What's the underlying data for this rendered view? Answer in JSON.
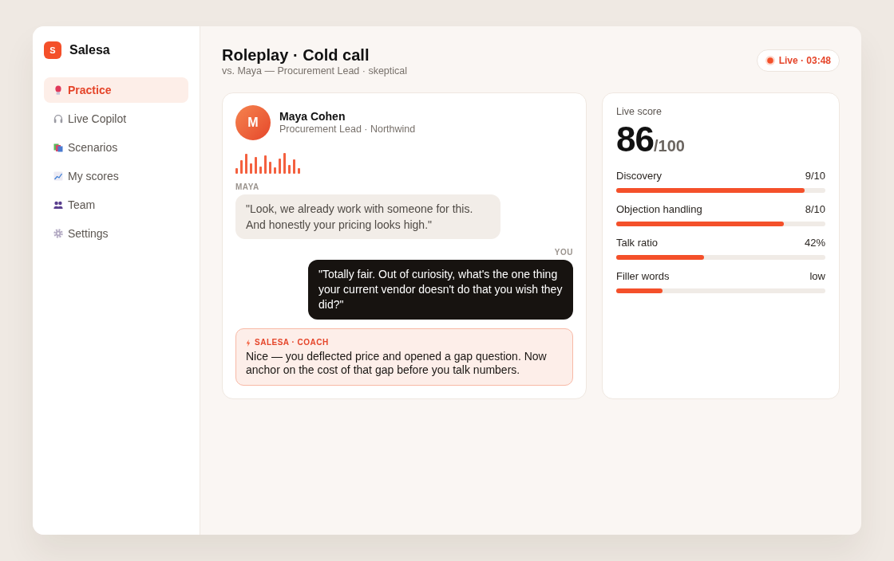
{
  "app": {
    "logo_letter": "S",
    "name": "Salesa"
  },
  "sidebar": {
    "items": [
      {
        "label": "Practice",
        "selected": true
      },
      {
        "label": "Live Copilot",
        "selected": false
      },
      {
        "label": "Scenarios",
        "selected": false
      },
      {
        "label": "My scores",
        "selected": false
      },
      {
        "label": "Team",
        "selected": false
      },
      {
        "label": "Settings",
        "selected": false
      }
    ]
  },
  "header": {
    "title": "Roleplay · Cold call",
    "subtitle": "vs. Maya — Procurement Lead · skeptical",
    "live_badge": {
      "label": "Live · 03:48"
    }
  },
  "conversation": {
    "contact": {
      "initial": "M",
      "name": "Maya Cohen",
      "role": "Procurement Lead · Northwind"
    },
    "messages": [
      {
        "kind": "prospect",
        "sender": "MAYA",
        "text": "\"Look, we already work with someone for this. And honestly your pricing looks high.\""
      },
      {
        "kind": "user",
        "sender": "YOU",
        "text": "\"Totally fair. Out of curiosity, what's the one thing your current vendor doesn't do that you wish they did?\""
      },
      {
        "kind": "coach",
        "sender": "SALESA · COACH",
        "text": "Nice — you deflected price and opened a gap question. Now anchor on the cost of that gap before you talk numbers."
      }
    ]
  },
  "score": {
    "title": "Live score",
    "value": "86",
    "max": "/100",
    "metrics": [
      {
        "label": "Discovery",
        "reading": "9/10",
        "level": 0.9
      },
      {
        "label": "Objection handling",
        "reading": "8/10",
        "level": 0.8
      },
      {
        "label": "Talk ratio",
        "reading": "42%",
        "level": 0.42
      },
      {
        "label": "Filler words",
        "reading": "low",
        "level": 0.22
      }
    ]
  }
}
